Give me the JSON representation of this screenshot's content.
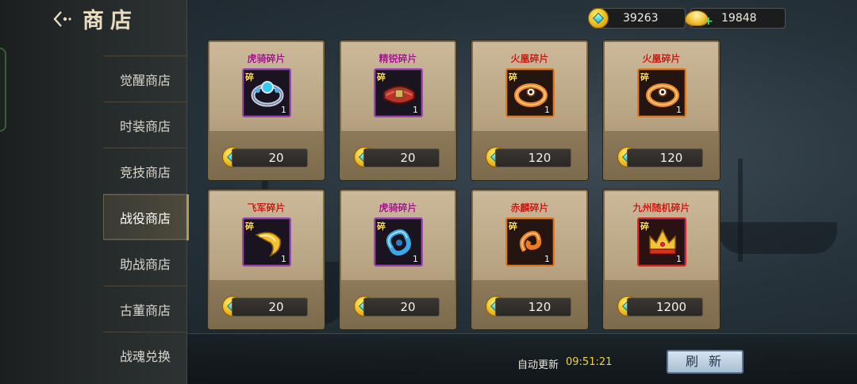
{
  "header": {
    "title": "商店"
  },
  "currencies": {
    "coins": {
      "value": "39263",
      "icon": "gold-coin-gem-icon"
    },
    "ingots": {
      "value": "19848",
      "icon": "gold-ingot-icon",
      "action": "+"
    }
  },
  "nav": {
    "items": [
      {
        "label": "觉醒商店",
        "active": false
      },
      {
        "label": "时装商店",
        "active": false
      },
      {
        "label": "竞技商店",
        "active": false
      },
      {
        "label": "战役商店",
        "active": true
      },
      {
        "label": "助战商店",
        "active": false
      },
      {
        "label": "古董商店",
        "active": false
      },
      {
        "label": "战魂兑换",
        "active": false
      }
    ]
  },
  "items": [
    {
      "name": "虎骑碎片",
      "tag": "碎",
      "count": "1",
      "price": "20",
      "icon": "blue-gem-bracelet-icon",
      "rarity": "purple"
    },
    {
      "name": "精锐碎片",
      "tag": "碎",
      "count": "1",
      "price": "20",
      "icon": "red-belt-icon",
      "rarity": "purple"
    },
    {
      "name": "火凰碎片",
      "tag": "碎",
      "count": "1",
      "price": "120",
      "icon": "orange-ring-icon",
      "rarity": "orange"
    },
    {
      "name": "火凰碎片",
      "tag": "碎",
      "count": "1",
      "price": "120",
      "icon": "orange-ring-icon",
      "rarity": "orange"
    },
    {
      "name": "飞军碎片",
      "tag": "碎",
      "count": "1",
      "price": "20",
      "icon": "gold-claw-icon",
      "rarity": "purple"
    },
    {
      "name": "虎骑碎片",
      "tag": "碎",
      "count": "1",
      "price": "20",
      "icon": "blue-dragon-jade-icon",
      "rarity": "purple"
    },
    {
      "name": "赤麟碎片",
      "tag": "碎",
      "count": "1",
      "price": "120",
      "icon": "orange-dragon-jade-icon",
      "rarity": "orange"
    },
    {
      "name": "九州随机碎片",
      "tag": "碎",
      "count": "1",
      "price": "1200",
      "icon": "gold-crown-icon",
      "rarity": "red"
    }
  ],
  "footer": {
    "auto_refresh_label": "自动更新",
    "auto_refresh_time": "09:51:21",
    "refresh_button": "刷 新"
  },
  "colors": {
    "purple_name": "#a01280",
    "red_name": "#c41a12",
    "timer": "#f2d23a",
    "card": "#b8a482"
  }
}
